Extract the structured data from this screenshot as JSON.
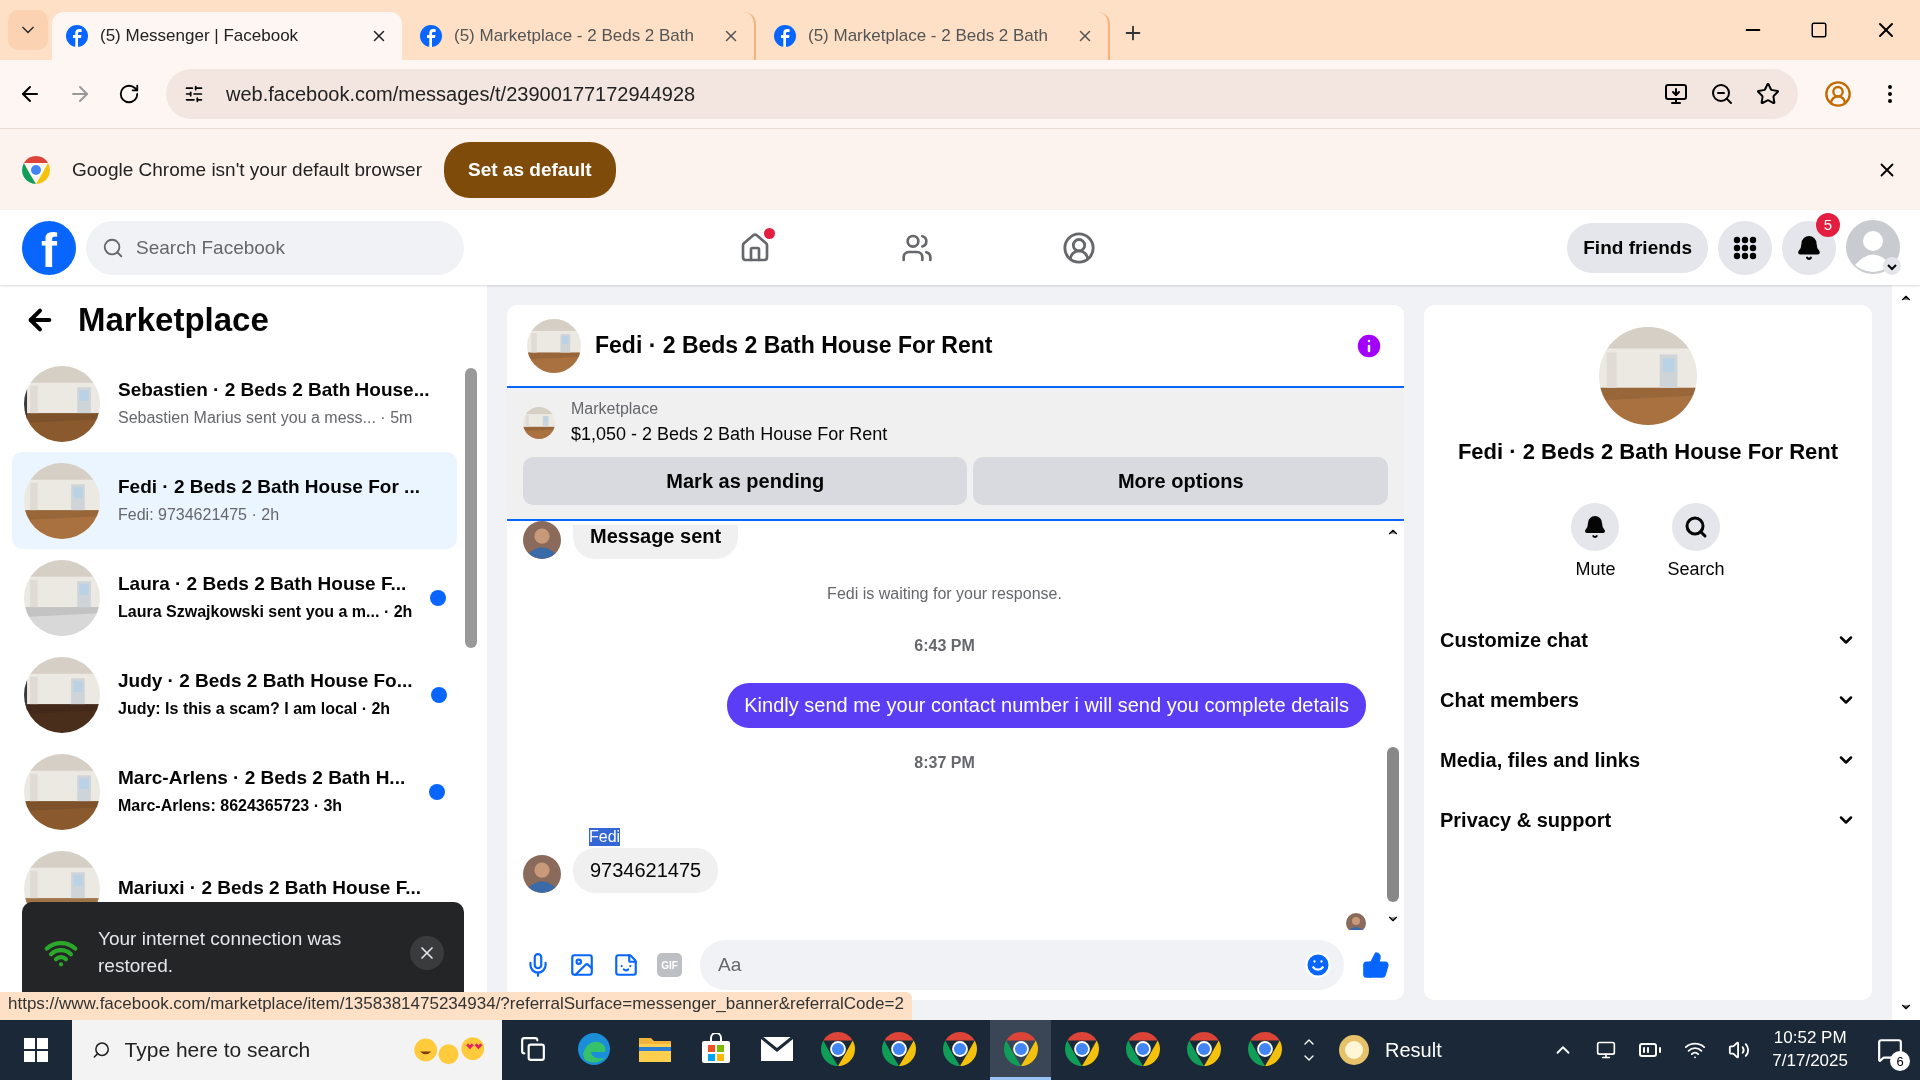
{
  "browser": {
    "tabs": [
      {
        "title": "(5) Messenger | Facebook",
        "selected": true
      },
      {
        "title": "(5) Marketplace - 2 Beds 2 Bath",
        "selected": false
      },
      {
        "title": "(5) Marketplace - 2 Beds 2 Bath",
        "selected": false
      }
    ],
    "url": "web.facebook.com/messages/t/23900177172944928",
    "infobar": {
      "message": "Google Chrome isn't your default browser",
      "button": "Set as default"
    },
    "status_url": "https://www.facebook.com/marketplace/item/1358381475234934/?referralSurface=messenger_banner&referralCode=2"
  },
  "header": {
    "logo": "f",
    "search": {
      "placeholder": "Search Facebook"
    },
    "nav": [
      {
        "kind": "home",
        "alert": true
      },
      {
        "kind": "friends",
        "alert": false
      },
      {
        "kind": "groups",
        "alert": false
      }
    ],
    "find_friends": "Find friends",
    "notification_count": "5"
  },
  "sidebar": {
    "title": "Marketplace",
    "conversations": [
      {
        "title": "Sebastien · 2 Beds 2 Bath House...",
        "preview": "Sebastien Marius sent you a mess...",
        "time": "· 5m",
        "unread": false,
        "selected": false
      },
      {
        "title": "Fedi · 2 Beds 2 Bath House For ...",
        "preview": "Fedi: 9734621475",
        "time": "· 2h",
        "unread": false,
        "selected": true
      },
      {
        "title": "Laura · 2 Beds 2 Bath House F...",
        "preview": "Laura Szwajkowski sent you a m...",
        "time": "· 2h",
        "unread": true,
        "selected": false
      },
      {
        "title": "Judy · 2 Beds 2 Bath House Fo...",
        "preview": "Judy: Is this a scam? I am local",
        "time": "· 2h",
        "unread": true,
        "selected": false
      },
      {
        "title": "Marc-Arlens · 2 Beds 2 Bath H...",
        "preview": "Marc-Arlens: 8624365723",
        "time": "· 3h",
        "unread": true,
        "selected": false
      },
      {
        "title": "Mariuxi · 2 Beds 2 Bath House F...",
        "unread": false,
        "selected": false
      }
    ]
  },
  "chat": {
    "title": "Fedi · 2 Beds 2 Bath House For Rent",
    "listing": {
      "source": "Marketplace",
      "title": "$1,050 - 2 Beds 2 Bath House For Rent"
    },
    "actions": [
      "Mark as pending",
      "More options"
    ],
    "messages": [
      {
        "kind": "incoming",
        "text": "Message sent"
      },
      {
        "kind": "notice",
        "text": "Fedi is waiting for your response."
      },
      {
        "kind": "time",
        "text": "6:43 PM"
      },
      {
        "kind": "outgoing",
        "text": "Kindly send me your contact number i will send you complete details"
      },
      {
        "kind": "time",
        "text": "8:37 PM"
      },
      {
        "kind": "sender",
        "text": "Fedi",
        "highlighted": true
      },
      {
        "kind": "incoming",
        "text": "9734621475"
      }
    ],
    "composer": {
      "gif": "GIF",
      "placeholder": "Aa"
    }
  },
  "details": {
    "title": "Fedi · 2 Beds 2 Bath House For Rent",
    "actions": [
      {
        "kind": "mute",
        "label": "Mute"
      },
      {
        "kind": "search",
        "label": "Search"
      }
    ],
    "sections": [
      {
        "label": "Customize chat",
        "expanded": false
      },
      {
        "label": "Chat members",
        "expanded": false
      },
      {
        "label": "Media, files and links",
        "expanded": false
      },
      {
        "label": "Privacy & support",
        "expanded": false
      }
    ]
  },
  "toast": {
    "message": "Your internet connection was restored."
  },
  "taskbar": {
    "search": {
      "placeholder": "Type here to search"
    },
    "apps": [
      {
        "kind": "taskview",
        "selected": false
      },
      {
        "kind": "edge",
        "selected": false
      },
      {
        "kind": "explorer",
        "selected": false
      },
      {
        "kind": "store",
        "selected": false
      },
      {
        "kind": "mail",
        "selected": false
      },
      {
        "kind": "chrome",
        "selected": false
      },
      {
        "kind": "chrome",
        "selected": false
      },
      {
        "kind": "chrome",
        "selected": false
      },
      {
        "kind": "chrome",
        "selected": true
      },
      {
        "kind": "chrome",
        "selected": false
      },
      {
        "kind": "chrome",
        "selected": false
      },
      {
        "kind": "chrome",
        "selected": false
      },
      {
        "kind": "chrome",
        "selected": false
      }
    ],
    "weather": "Result",
    "time": "10:52 PM",
    "date": "7/17/2025",
    "notifications": "6"
  }
}
